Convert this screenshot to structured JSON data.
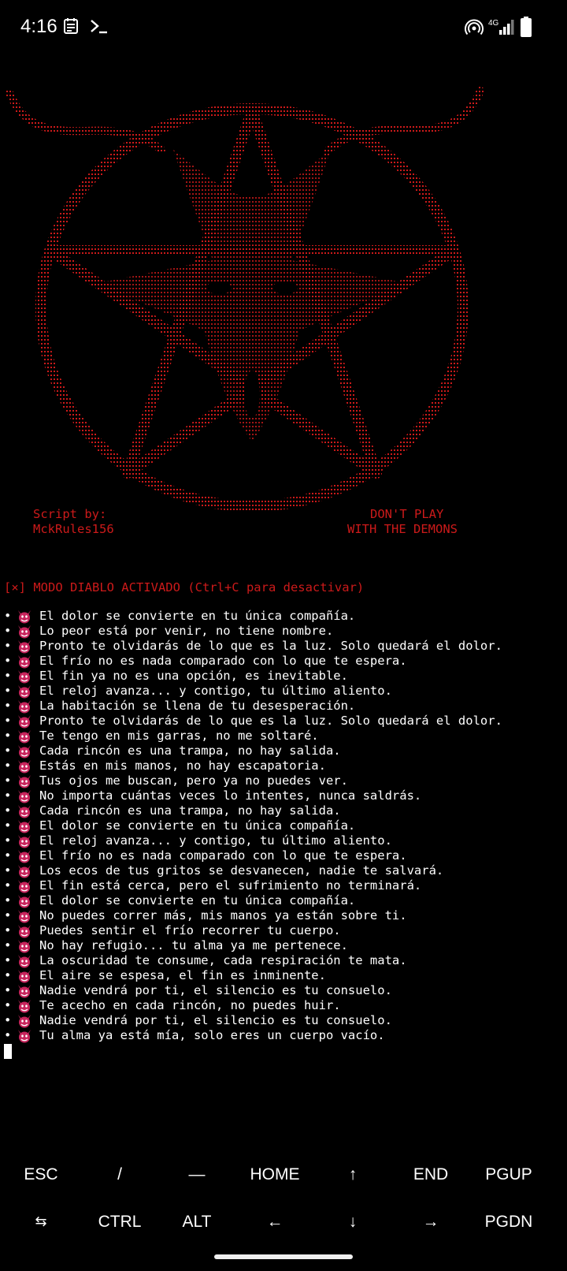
{
  "status_bar": {
    "time": "4:16",
    "icons": [
      "calendar-icon",
      "terminal-prompt-icon",
      "hotspot-icon",
      "signal-4g-icon",
      "battery-icon"
    ],
    "network": "4G"
  },
  "art": {
    "script_by_label": "Script by:",
    "author": "MckRules156",
    "warning_line1": "DON'T PLAY",
    "warning_line2": "WITH THE DEMONS",
    "color": "#cc1a1a"
  },
  "terminal": {
    "mode_line": "[×] MODO DIABLO ACTIVADO (Ctrl+C para desactivar)",
    "bullet": "•",
    "messages": [
      "El dolor se convierte en tu única compañía.",
      "Lo peor está por venir, no tiene nombre.",
      "Pronto te olvidarás de lo que es la luz. Solo quedará el dolor.",
      "El frío no es nada comparado con lo que te espera.",
      "El fin ya no es una opción, es inevitable.",
      "El reloj avanza... y contigo, tu último aliento.",
      "La habitación se llena de tu desesperación.",
      "Pronto te olvidarás de lo que es la luz. Solo quedará el dolor.",
      "Te tengo en mis garras, no me soltaré.",
      "Cada rincón es una trampa, no hay salida.",
      "Estás en mis manos, no hay escapatoria.",
      "Tus ojos me buscan, pero ya no puedes ver.",
      "No importa cuántas veces lo intentes, nunca saldrás.",
      "Cada rincón es una trampa, no hay salida.",
      "El dolor se convierte en tu única compañía.",
      "El reloj avanza... y contigo, tu último aliento.",
      "El frío no es nada comparado con lo que te espera.",
      "Los ecos de tus gritos se desvanecen, nadie te salvará.",
      "El fin está cerca, pero el sufrimiento no terminará.",
      "El dolor se convierte en tu única compañía.",
      "No puedes correr más, mis manos ya están sobre ti.",
      "Puedes sentir el frío recorrer tu cuerpo.",
      "No hay refugio... tu alma ya me pertenece.",
      "La oscuridad te consume, cada respiración te mata.",
      "El aire se espesa, el fin es inminente.",
      "Nadie vendrá por ti, el silencio es tu consuelo.",
      "Te acecho en cada rincón, no puedes huir.",
      "Nadie vendrá por ti, el silencio es tu consuelo.",
      "Tu alma ya está mía, solo eres un cuerpo vacío."
    ],
    "message_icon": "devil-face-icon",
    "accent_color": "#cc1a1a"
  },
  "extra_keys": {
    "row1": [
      "ESC",
      "/",
      "—",
      "HOME",
      "↑",
      "END",
      "PGUP"
    ],
    "row2": [
      "⇆",
      "CTRL",
      "ALT",
      "←",
      "↓",
      "→",
      "PGDN"
    ]
  }
}
